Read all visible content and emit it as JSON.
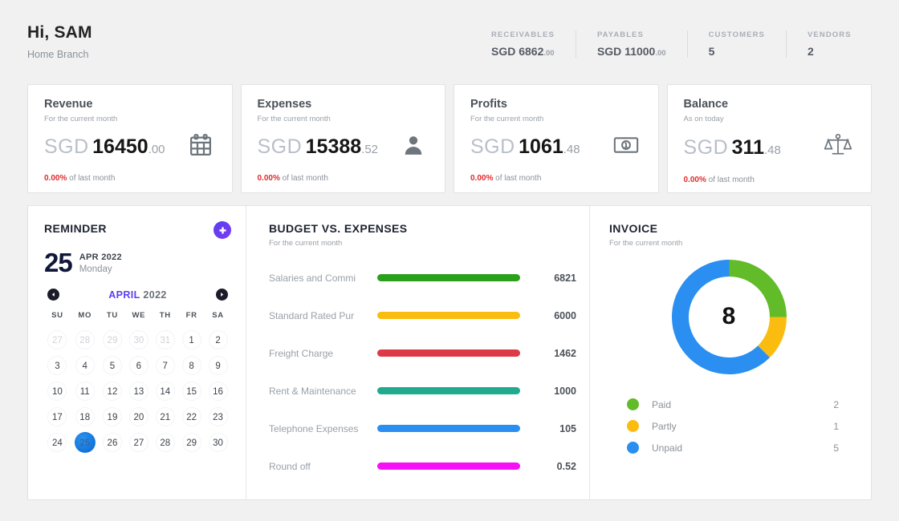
{
  "header": {
    "greeting": "Hi, SAM",
    "branch": "Home Branch",
    "stats": [
      {
        "label": "RECEIVABLES",
        "currency": "SGD 6862",
        "cents": ".00"
      },
      {
        "label": "PAYABLES",
        "currency": "SGD 11000",
        "cents": ".00"
      },
      {
        "label": "CUSTOMERS",
        "currency": "5",
        "cents": ""
      },
      {
        "label": "VENDORS",
        "currency": "2",
        "cents": ""
      }
    ]
  },
  "kpi_cards": [
    {
      "title": "Revenue",
      "subtitle": "For the current month",
      "currency": "SGD",
      "integer": "16450",
      "decimal": ".00",
      "change_pct": "0.00%",
      "change_text": "of last month",
      "icon": "calendar-icon"
    },
    {
      "title": "Expenses",
      "subtitle": "For the current month",
      "currency": "SGD",
      "integer": "15388",
      "decimal": ".52",
      "change_pct": "0.00%",
      "change_text": "of last month",
      "icon": "person-icon"
    },
    {
      "title": "Profits",
      "subtitle": "For the current month",
      "currency": "SGD",
      "integer": "1061",
      "decimal": ".48",
      "change_pct": "0.00%",
      "change_text": "of last month",
      "icon": "banknote-icon"
    },
    {
      "title": "Balance",
      "subtitle": "As on today",
      "currency": "SGD",
      "integer": "311",
      "decimal": ".48",
      "change_pct": "0.00%",
      "change_text": "of last month",
      "icon": "scales-icon"
    }
  ],
  "reminder": {
    "title": "REMINDER",
    "add_icon": "plus-circle-icon",
    "day_number": "25",
    "month_year": "APR 2022",
    "weekday": "Monday",
    "prev_icon": "chevron-left-icon",
    "next_icon": "chevron-right-icon",
    "cal_month": "APRIL",
    "cal_year": "2022",
    "weekday_headers": [
      "SU",
      "MO",
      "TU",
      "WE",
      "TH",
      "FR",
      "SA"
    ],
    "selected_day": 25,
    "weeks": [
      [
        {
          "d": "27",
          "muted": true
        },
        {
          "d": "28",
          "muted": true
        },
        {
          "d": "29",
          "muted": true
        },
        {
          "d": "30",
          "muted": true
        },
        {
          "d": "31",
          "muted": true
        },
        {
          "d": "1",
          "muted": false
        },
        {
          "d": "2",
          "muted": false
        }
      ],
      [
        {
          "d": "3",
          "muted": false
        },
        {
          "d": "4",
          "muted": false
        },
        {
          "d": "5",
          "muted": false
        },
        {
          "d": "6",
          "muted": false
        },
        {
          "d": "7",
          "muted": false
        },
        {
          "d": "8",
          "muted": false
        },
        {
          "d": "9",
          "muted": false
        }
      ],
      [
        {
          "d": "10",
          "muted": false
        },
        {
          "d": "11",
          "muted": false
        },
        {
          "d": "12",
          "muted": false
        },
        {
          "d": "13",
          "muted": false
        },
        {
          "d": "14",
          "muted": false
        },
        {
          "d": "15",
          "muted": false
        },
        {
          "d": "16",
          "muted": false
        }
      ],
      [
        {
          "d": "17",
          "muted": false
        },
        {
          "d": "18",
          "muted": false
        },
        {
          "d": "19",
          "muted": false
        },
        {
          "d": "20",
          "muted": false
        },
        {
          "d": "21",
          "muted": false
        },
        {
          "d": "22",
          "muted": false
        },
        {
          "d": "23",
          "muted": false
        }
      ],
      [
        {
          "d": "24",
          "muted": false
        },
        {
          "d": "25",
          "muted": false
        },
        {
          "d": "26",
          "muted": false
        },
        {
          "d": "27",
          "muted": false
        },
        {
          "d": "28",
          "muted": false
        },
        {
          "d": "29",
          "muted": false
        },
        {
          "d": "30",
          "muted": false
        }
      ]
    ]
  },
  "budget": {
    "title": "BUDGET VS. EXPENSES",
    "subtitle": "For the current month"
  },
  "invoice": {
    "title": "INVOICE",
    "subtitle": "For the current month",
    "total": "8"
  },
  "chart_data": [
    {
      "type": "bar",
      "title": "BUDGET VS. EXPENSES",
      "subtitle": "For the current month",
      "orientation": "horizontal",
      "categories": [
        "Salaries and Commi",
        "Standard Rated Pur",
        "Freight Charge",
        "Rent & Maintenance",
        "Telephone Expenses",
        "Round off"
      ],
      "values": [
        6821,
        6000,
        1462,
        1000,
        105,
        0.52
      ],
      "value_labels": [
        "6821",
        "6000",
        "1462",
        "1000",
        "105",
        "0.52"
      ],
      "colors": [
        "#2ba01b",
        "#fbbc10",
        "#dc3a48",
        "#20ab8e",
        "#2a8ff0",
        "#f510f5"
      ],
      "bars_full_width": true,
      "grid": false,
      "legend": "none",
      "xlabel": "",
      "ylabel": ""
    },
    {
      "type": "pie",
      "variant": "donut",
      "title": "INVOICE",
      "subtitle": "For the current month",
      "center_label": "8",
      "labels": [
        "Paid",
        "Partly",
        "Unpaid"
      ],
      "values": [
        2,
        1,
        5
      ],
      "colors": [
        "#62bb28",
        "#fbbc10",
        "#2a8ff0"
      ],
      "legend": "bottom-left"
    }
  ]
}
